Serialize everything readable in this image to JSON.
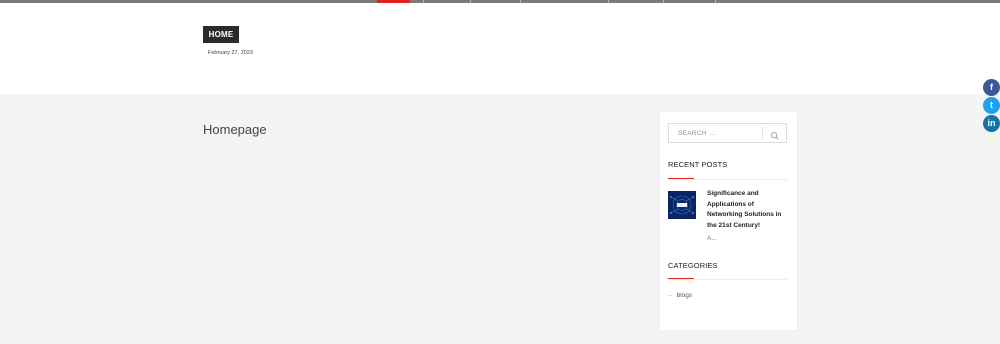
{
  "header": {
    "home_badge": "HOME",
    "date": "February 27, 2023"
  },
  "main": {
    "page_title": "Homepage"
  },
  "sidebar": {
    "search": {
      "placeholder": "SEARCH ...",
      "icon": "search-icon"
    },
    "recent_posts": {
      "title": "RECENT POSTS",
      "posts": [
        {
          "title": "Significance and Applications of Networking Solutions in the 21st Century!",
          "excerpt": "A..."
        }
      ]
    },
    "categories": {
      "title": "CATEGORIES",
      "items": [
        {
          "label": "blogs"
        }
      ]
    }
  },
  "social": {
    "facebook": "f",
    "twitter": "t",
    "linkedin": "in"
  },
  "colors": {
    "accent": "#e0241b",
    "facebook": "#3b5998",
    "twitter": "#1da1f2",
    "linkedin": "#0e76a8"
  }
}
